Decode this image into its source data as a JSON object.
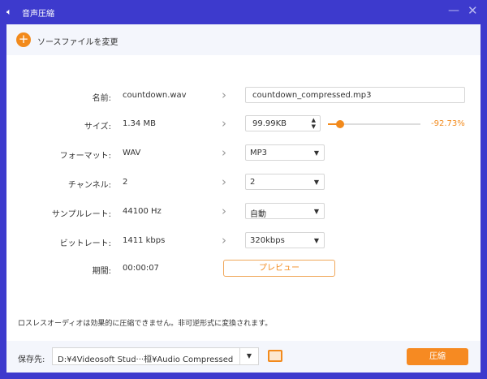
{
  "window": {
    "title": "音声圧縮",
    "icon": "speaker-icon",
    "minimize": "—",
    "close": "✕"
  },
  "toolbar": {
    "change_source": "ソースファイルを変更"
  },
  "rows": [
    {
      "label": "名前:",
      "value": "countdown.wav",
      "output": "countdown_compressed.mp3"
    },
    {
      "label": "サイズ:",
      "value": "1.34 MB",
      "output": "99.99KB",
      "percent": "-92.73%",
      "slider_fraction": 0.13
    },
    {
      "label": "フォーマット:",
      "value": "WAV",
      "output": "MP3"
    },
    {
      "label": "チャンネル:",
      "value": "2",
      "output": "2"
    },
    {
      "label": "サンプルレート:",
      "value": "44100 Hz",
      "output": "自動"
    },
    {
      "label": "ビットレート:",
      "value": "1411 kbps",
      "output": "320kbps"
    },
    {
      "label": "期間:",
      "value": "00:00:07"
    }
  ],
  "preview_label": "プレビュー",
  "note": "ロスレスオーディオは効果的に圧縮できません。非可逆形式に変換されます。",
  "footer": {
    "save_label": "保存先:",
    "path": "D:¥4Videosoft Stud···桓¥Audio Compressed",
    "compress": "圧縮"
  },
  "colors": {
    "accent": "#f28a1c",
    "titlebar": "#3d3acd"
  }
}
